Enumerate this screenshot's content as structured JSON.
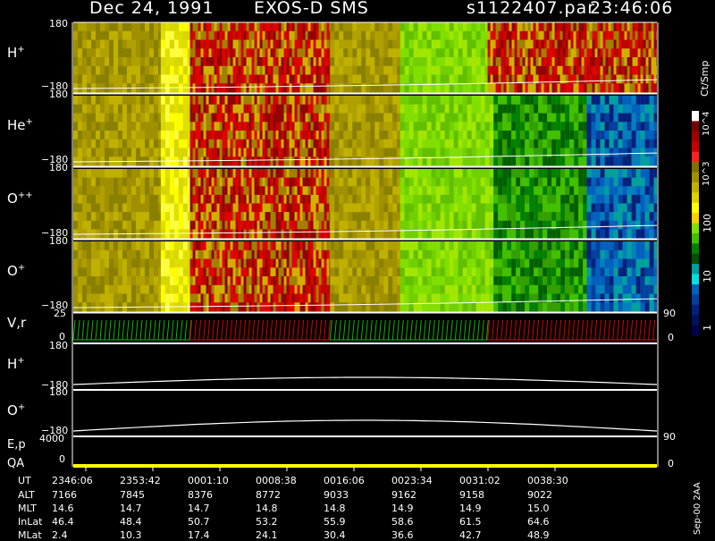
{
  "header": {
    "date": "Dec 24, 1991",
    "instrument": "EXOS-D SMS",
    "filename": "s1122407.par",
    "time": "23:46:06"
  },
  "colorbar": {
    "unit": "Ct/Smp",
    "labels": [
      "10^4",
      "10^3",
      "100",
      "10",
      "1"
    ],
    "colors": [
      "#ffffff",
      "#7a0000",
      "#a00000",
      "#c80000",
      "#ff2020",
      "#807000",
      "#a09000",
      "#c0b000",
      "#e0d000",
      "#ffff00",
      "#ffd000",
      "#80e000",
      "#40c000",
      "#008000",
      "#005000",
      "#00a0a0",
      "#00e0e0",
      "#0060c0",
      "#0040a0",
      "#002080",
      "#001060",
      "#000050"
    ]
  },
  "panels": [
    {
      "id": "h-plus",
      "label": "H",
      "sup": "+",
      "ymax": "180",
      "ymin": "−180"
    },
    {
      "id": "he-plus",
      "label": "He",
      "sup": "+",
      "ymax": "180",
      "ymin": "−180"
    },
    {
      "id": "o-plus-plus",
      "label": "O",
      "sup": "++",
      "ymax": "180",
      "ymin": "−180"
    },
    {
      "id": "o-plus",
      "label": "O",
      "sup": "+",
      "ymax": "180",
      "ymin": "−180"
    }
  ],
  "vr_panel": {
    "label": "V,r",
    "ymax": "25",
    "ymin": "0",
    "right_top": "90",
    "right_bottom": "0"
  },
  "line_panels": [
    {
      "id": "line-h-plus",
      "label": "H",
      "sup": "+",
      "ymax": "180",
      "ymin": "−180"
    },
    {
      "id": "line-o-plus",
      "label": "O",
      "sup": "+",
      "ymax": "180",
      "ymin": "−180"
    }
  ],
  "ep_panel": {
    "label": "E,p",
    "ymax": "4000",
    "right_top": "90"
  },
  "qa_panel": {
    "label": "QA",
    "ymin": "0",
    "right_bottom": "0"
  },
  "footer": {
    "row_labels": [
      "UT",
      "ALT",
      "MLT",
      "InLat",
      "MLat"
    ],
    "columns": [
      {
        "UT": "2346:06",
        "ALT": "7166",
        "MLT": "14.6",
        "InLat": "46.4",
        "MLat": "2.4"
      },
      {
        "UT": "2353:42",
        "ALT": "7845",
        "MLT": "14.7",
        "InLat": "48.4",
        "MLat": "10.3"
      },
      {
        "UT": "0001:10",
        "ALT": "8376",
        "MLT": "14.7",
        "InLat": "50.7",
        "MLat": "17.4"
      },
      {
        "UT": "0008:38",
        "ALT": "8772",
        "MLT": "14.8",
        "InLat": "53.2",
        "MLat": "24.1"
      },
      {
        "UT": "0016:06",
        "ALT": "9033",
        "MLT": "14.8",
        "InLat": "55.9",
        "MLat": "30.4"
      },
      {
        "UT": "0023:34",
        "ALT": "9162",
        "MLT": "14.9",
        "InLat": "58.6",
        "MLat": "36.6"
      },
      {
        "UT": "0031:02",
        "ALT": "9158",
        "MLT": "14.9",
        "InLat": "61.5",
        "MLat": "42.7"
      },
      {
        "UT": "0038:30",
        "ALT": "9022",
        "MLT": "15.0",
        "InLat": "64.6",
        "MLat": "48.9"
      }
    ],
    "credit": "Sep-00  2AA"
  },
  "chart_data": {
    "type": "heatmap",
    "title": "Dec 24, 1991   EXOS-D SMS",
    "x_labels": [
      "2346:06",
      "2353:42",
      "0001:10",
      "0008:38",
      "0016:06",
      "0023:34",
      "0031:02",
      "0038:30"
    ],
    "y_range": [
      -180,
      180
    ],
    "colorbar_range_ct_per_smp": [
      1,
      10000
    ],
    "colorbar_scale": "log",
    "series": [
      {
        "name": "H+",
        "segments": [
          {
            "t0": 0.0,
            "t1": 0.15,
            "level": "olive"
          },
          {
            "t0": 0.15,
            "t1": 0.2,
            "level": "yellow"
          },
          {
            "t0": 0.2,
            "t1": 0.2,
            "level": "green"
          },
          {
            "t0": 0.2,
            "t1": 0.44,
            "level": "red-striped"
          },
          {
            "t0": 0.44,
            "t1": 0.56,
            "level": "olive"
          },
          {
            "t0": 0.56,
            "t1": 0.71,
            "level": "green"
          },
          {
            "t0": 0.71,
            "t1": 1.0,
            "level": "red-striped"
          }
        ]
      },
      {
        "name": "He+",
        "segments": [
          {
            "t0": 0.0,
            "t1": 0.15,
            "level": "olive"
          },
          {
            "t0": 0.15,
            "t1": 0.2,
            "level": "yellow"
          },
          {
            "t0": 0.2,
            "t1": 0.44,
            "level": "red-striped"
          },
          {
            "t0": 0.44,
            "t1": 0.56,
            "level": "olive"
          },
          {
            "t0": 0.56,
            "t1": 0.72,
            "level": "green"
          },
          {
            "t0": 0.72,
            "t1": 0.88,
            "level": "darkgreen"
          },
          {
            "t0": 0.88,
            "t1": 1.0,
            "level": "blue"
          }
        ]
      },
      {
        "name": "O++",
        "segments": [
          {
            "t0": 0.0,
            "t1": 0.15,
            "level": "olive"
          },
          {
            "t0": 0.15,
            "t1": 0.2,
            "level": "yellow"
          },
          {
            "t0": 0.2,
            "t1": 0.44,
            "level": "red-striped"
          },
          {
            "t0": 0.44,
            "t1": 0.56,
            "level": "olive"
          },
          {
            "t0": 0.56,
            "t1": 0.72,
            "level": "green"
          },
          {
            "t0": 0.72,
            "t1": 0.88,
            "level": "darkgreen"
          },
          {
            "t0": 0.88,
            "t1": 1.0,
            "level": "blue"
          }
        ]
      },
      {
        "name": "O+",
        "segments": [
          {
            "t0": 0.0,
            "t1": 0.15,
            "level": "olive"
          },
          {
            "t0": 0.15,
            "t1": 0.2,
            "level": "yellow"
          },
          {
            "t0": 0.2,
            "t1": 0.44,
            "level": "red-striped"
          },
          {
            "t0": 0.44,
            "t1": 0.56,
            "level": "olive"
          },
          {
            "t0": 0.56,
            "t1": 0.72,
            "level": "green"
          },
          {
            "t0": 0.72,
            "t1": 0.88,
            "level": "darkgreen"
          },
          {
            "t0": 0.88,
            "t1": 1.0,
            "level": "blue"
          }
        ]
      }
    ],
    "vr_segments": [
      {
        "t0": 0.0,
        "t1": 0.2,
        "color": "#00c000"
      },
      {
        "t0": 0.2,
        "t1": 0.44,
        "color": "#e00000"
      },
      {
        "t0": 0.44,
        "t1": 0.71,
        "color": "#00c000"
      },
      {
        "t0": 0.71,
        "t1": 1.0,
        "color": "#e00000"
      }
    ],
    "qa_color": "#ffff00"
  }
}
